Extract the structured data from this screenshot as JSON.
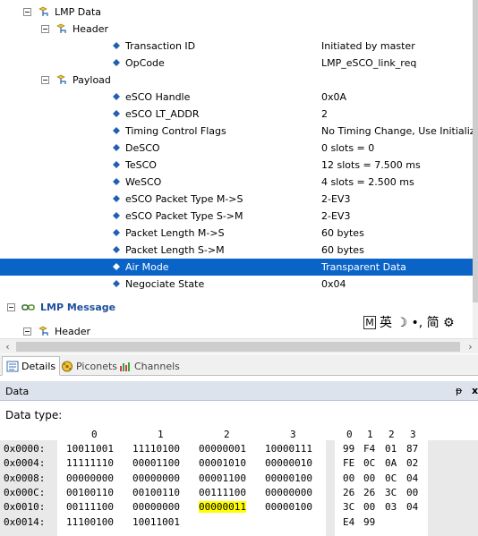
{
  "tree": {
    "rows": [
      {
        "label": "LMP Data",
        "value": "",
        "kind": "group"
      },
      {
        "label": "Header",
        "value": "",
        "kind": "group"
      },
      {
        "label": "Transaction ID",
        "value": "Initiated by master",
        "kind": "field"
      },
      {
        "label": "OpCode",
        "value": "LMP_eSCO_link_req",
        "kind": "field"
      },
      {
        "label": "Payload",
        "value": "",
        "kind": "group"
      },
      {
        "label": "eSCO Handle",
        "value": "0x0A",
        "kind": "field"
      },
      {
        "label": "eSCO LT_ADDR",
        "value": "2",
        "kind": "field"
      },
      {
        "label": "Timing Control Flags",
        "value": "No Timing Change, Use Initialization",
        "kind": "field"
      },
      {
        "label": "DeSCO",
        "value": "0 slots = 0",
        "kind": "field"
      },
      {
        "label": "TeSCO",
        "value": "12 slots = 7.500 ms",
        "kind": "field"
      },
      {
        "label": "WeSCO",
        "value": "4 slots = 2.500 ms",
        "kind": "field"
      },
      {
        "label": "eSCO Packet Type M->S",
        "value": "2-EV3",
        "kind": "field"
      },
      {
        "label": "eSCO Packet Type S->M",
        "value": "2-EV3",
        "kind": "field"
      },
      {
        "label": "Packet Length M->S",
        "value": "60 bytes",
        "kind": "field"
      },
      {
        "label": "Packet Length S->M",
        "value": "60 bytes",
        "kind": "field"
      },
      {
        "label": "Air Mode",
        "value": "Transparent Data",
        "kind": "field",
        "selected": true
      },
      {
        "label": "Negociate State",
        "value": "0x04",
        "kind": "field"
      },
      {
        "label": "LMP Message",
        "value": "",
        "kind": "message"
      },
      {
        "label": "Header",
        "value": "",
        "kind": "group"
      }
    ],
    "ime": {
      "m": "M",
      "chars": "英 ☽ •, 简 ⚙"
    }
  },
  "tabs": [
    {
      "label": "Details",
      "active": true
    },
    {
      "label": "Piconets",
      "active": false
    },
    {
      "label": "Channels",
      "active": false
    }
  ],
  "data_panel": {
    "title": "Data",
    "pin": "ᵽ",
    "close": "x",
    "data_type_label": "Data type:",
    "bin_col_headers": [
      "0",
      "1",
      "2",
      "3"
    ],
    "hex_col_headers": [
      "0",
      "1",
      "2",
      "3"
    ],
    "rows": [
      {
        "addr": "0x0000:",
        "bin": [
          "10011001",
          "11110100",
          "00000001",
          "10000111"
        ],
        "hex": [
          "99",
          "F4",
          "01",
          "87"
        ]
      },
      {
        "addr": "0x0004:",
        "bin": [
          "11111110",
          "00001100",
          "00001010",
          "00000010"
        ],
        "hex": [
          "FE",
          "0C",
          "0A",
          "02"
        ]
      },
      {
        "addr": "0x0008:",
        "bin": [
          "00000000",
          "00000000",
          "00001100",
          "00000100"
        ],
        "hex": [
          "00",
          "00",
          "0C",
          "04"
        ]
      },
      {
        "addr": "0x000C:",
        "bin": [
          "00100110",
          "00100110",
          "00111100",
          "00000000"
        ],
        "hex": [
          "26",
          "26",
          "3C",
          "00"
        ]
      },
      {
        "addr": "0x0010:",
        "bin": [
          "00111100",
          "00000000",
          "00000011",
          "00000100"
        ],
        "hex": [
          "3C",
          "00",
          "03",
          "04"
        ]
      },
      {
        "addr": "0x0014:",
        "bin": [
          "11100100",
          "10011001"
        ],
        "hex": [
          "E4",
          "99"
        ]
      }
    ],
    "highlight": {
      "row": 4,
      "col": 2,
      "color": "#ffff00"
    }
  },
  "colors": {
    "selection": "#0a64c8",
    "message_text": "#1f4f9e",
    "highlight": "#ffff00"
  }
}
